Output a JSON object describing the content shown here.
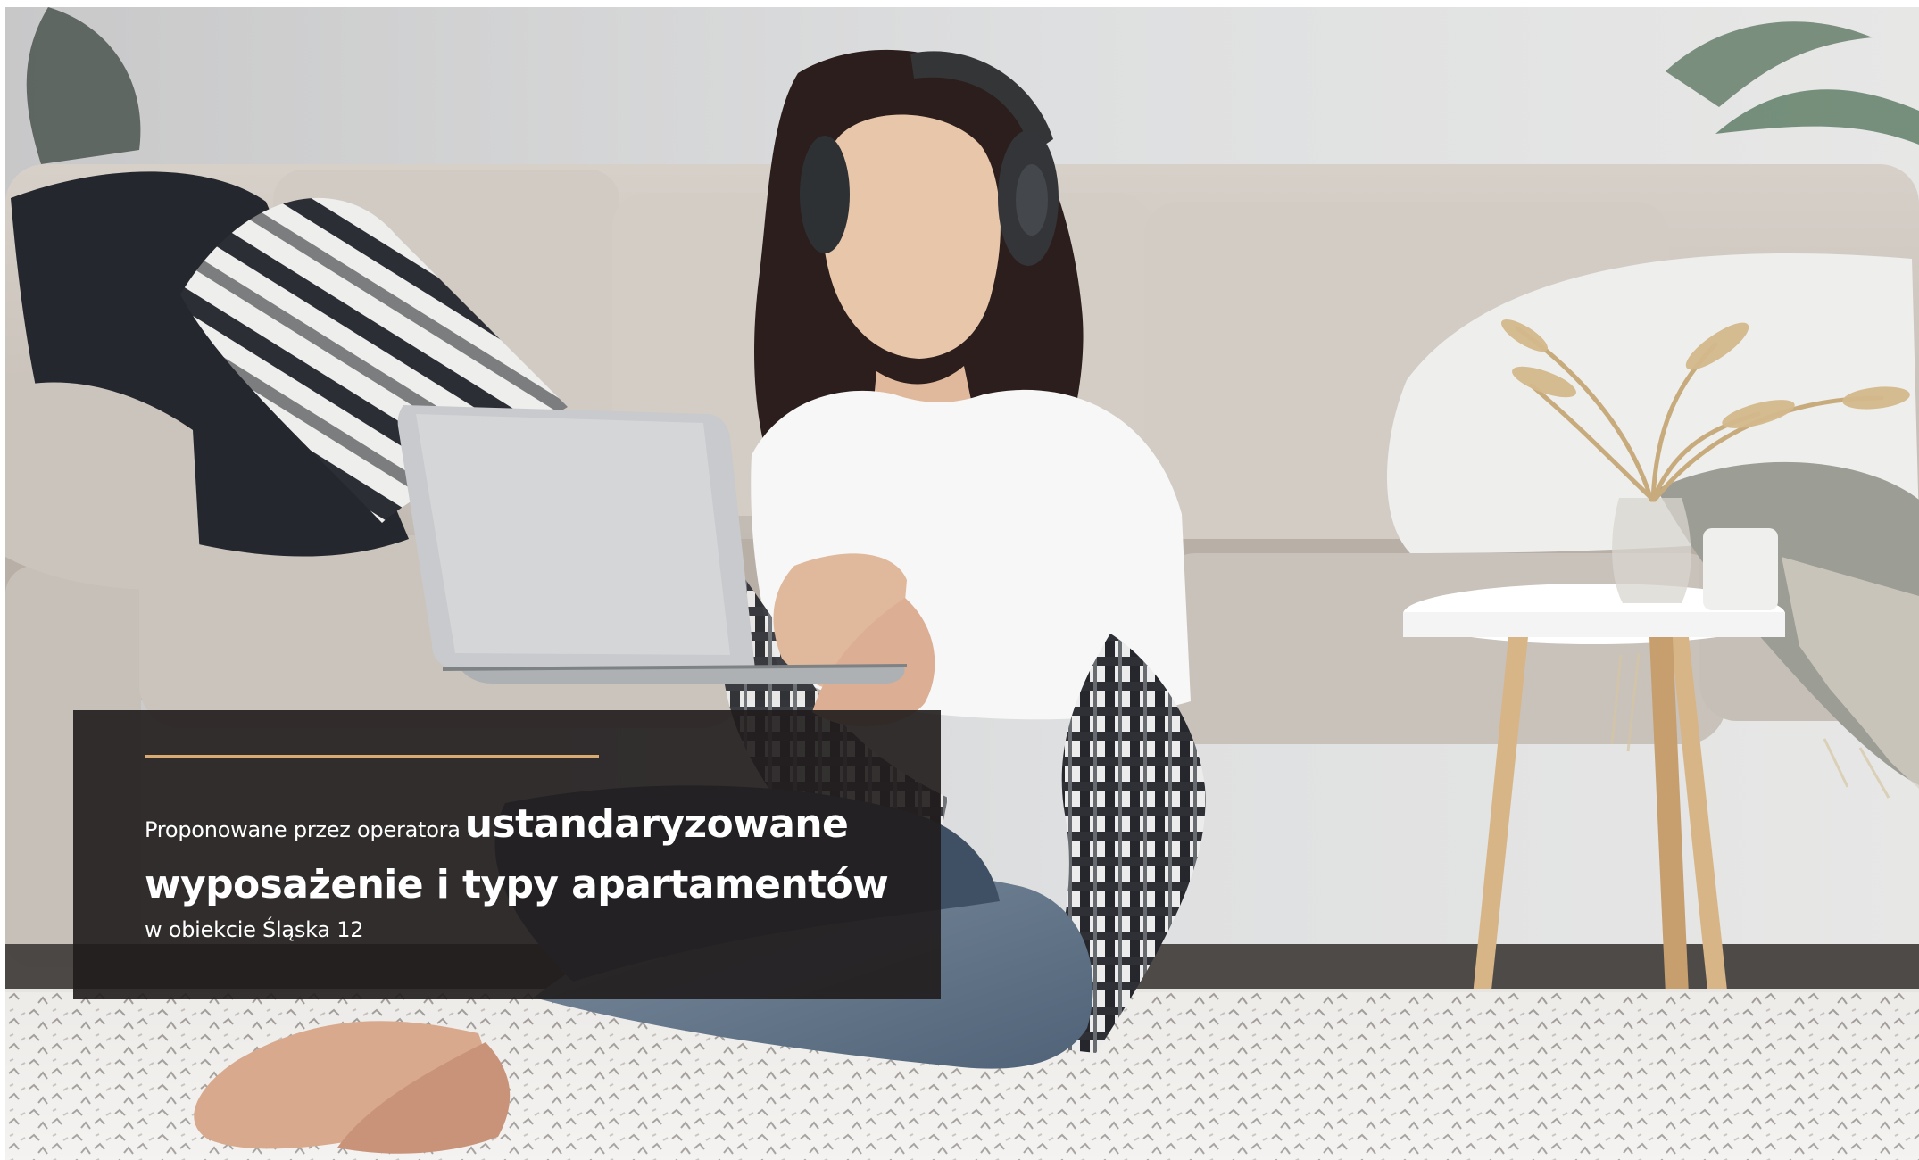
{
  "caption": {
    "lead": "Proponowane przez operatora",
    "highlight_line_1": "ustandaryzowane",
    "highlight_line_2": "wyposażenie i typy apartamentów",
    "subtitle": "w obiekcie Śląska 12"
  },
  "colors": {
    "accent_rule": "#d9aa72",
    "panel": "#211d1d",
    "sofa": "#cfc8c0",
    "rug": "#eeeeeb",
    "table_wood": "#d8b587",
    "dried_flowers": "#c8ab7d"
  }
}
